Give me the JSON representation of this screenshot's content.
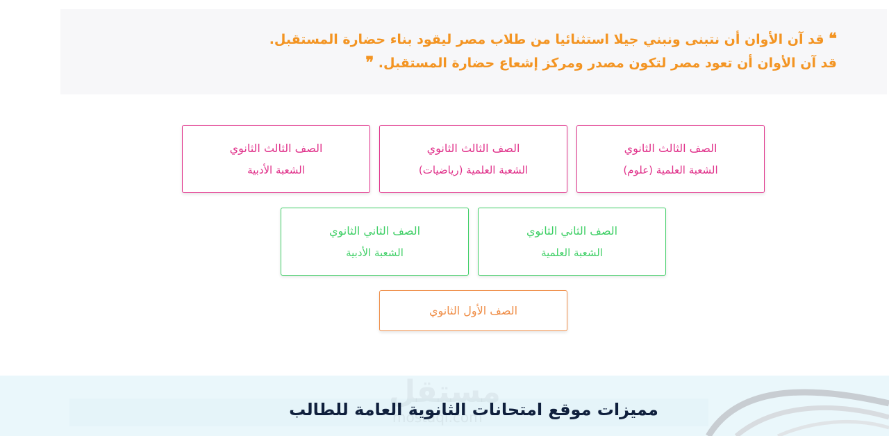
{
  "quote": {
    "line1": "قد آن الأوان أن نتبنى ونبني جيلا استثنائيا من طلاب مصر ليقود بناء حضارة المستقبل.",
    "line2": "قد آن الأوان أن تعود مصر لتكون مصدر ومركز إشعاع حضارة المستقبل.",
    "open_mark": "❝",
    "close_mark": "❞"
  },
  "cards": {
    "third_science": {
      "title": "الصف الثالث الثانوي",
      "subtitle": "الشعبة العلمية (علوم)"
    },
    "third_math": {
      "title": "الصف الثالث الثانوي",
      "subtitle": "الشعبة العلمية (رياضيات)"
    },
    "third_literary": {
      "title": "الصف الثالث الثانوي",
      "subtitle": "الشعبة الأدبية"
    },
    "second_science": {
      "title": "الصف الثاني الثانوي",
      "subtitle": "الشعبة العلمية"
    },
    "second_literary": {
      "title": "الصف الثاني الثانوي",
      "subtitle": "الشعبة الأدبية"
    },
    "first": {
      "title": "الصف الأول الثانوي"
    }
  },
  "colors": {
    "third": "#e0318a",
    "second": "#3fcf66",
    "first": "#ef8d46",
    "quote": "#f39422"
  },
  "features": {
    "title": "مميزات موقع امتحانات الثانوية العامة للطالب"
  },
  "watermark": {
    "arabic": "مستقل",
    "latin": "mostaql.com"
  }
}
